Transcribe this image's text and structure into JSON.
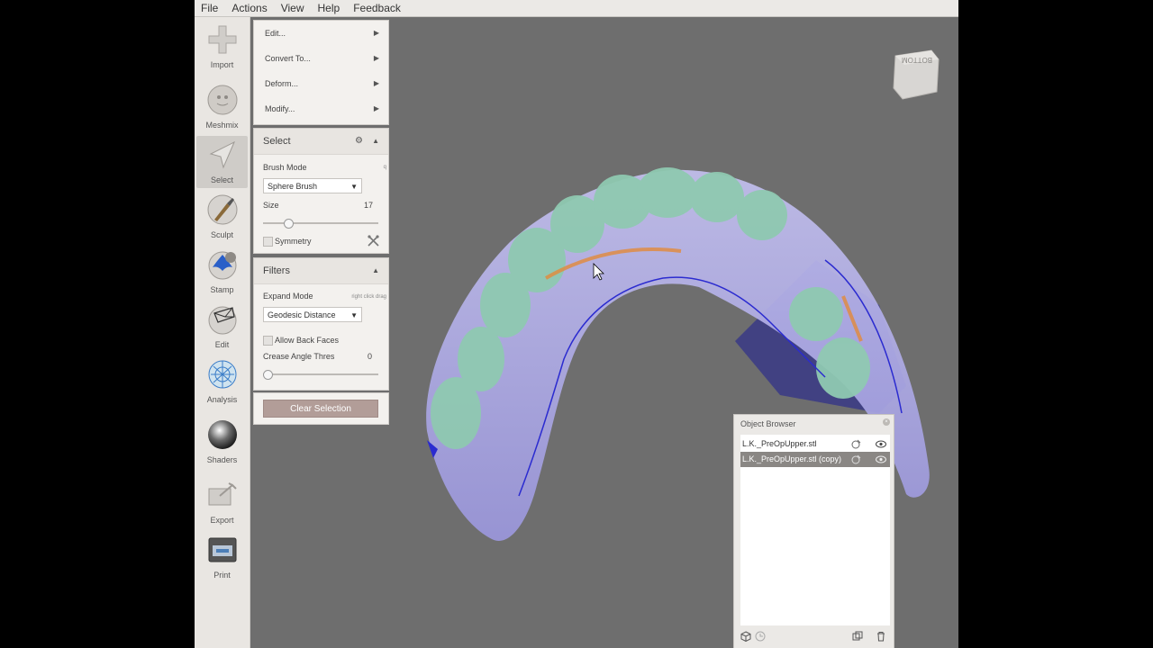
{
  "menubar": {
    "items": [
      "File",
      "Actions",
      "View",
      "Help",
      "Feedback"
    ]
  },
  "toolbar": {
    "tools": [
      {
        "label": "Import",
        "icon": "plus-icon"
      },
      {
        "label": "Meshmix",
        "icon": "meshmix-icon"
      },
      {
        "label": "Select",
        "icon": "select-arrow-icon",
        "active": true
      },
      {
        "label": "Sculpt",
        "icon": "brush-icon"
      },
      {
        "label": "Stamp",
        "icon": "stamp-icon"
      },
      {
        "label": "Edit",
        "icon": "edit-mesh-icon"
      },
      {
        "label": "Analysis",
        "icon": "analysis-icon"
      },
      {
        "label": "Shaders",
        "icon": "shader-sphere-icon"
      },
      {
        "label": "Export",
        "icon": "export-icon"
      },
      {
        "label": "Print",
        "icon": "printer-icon"
      }
    ]
  },
  "edit_menu": {
    "items": [
      "Edit...",
      "Convert To...",
      "Deform...",
      "Modify..."
    ]
  },
  "select_panel": {
    "title": "Select",
    "brush_mode_label": "Brush Mode",
    "brush_mode_hint": "q",
    "brush_mode_value": "Sphere Brush",
    "size_label": "Size",
    "size_value": "17",
    "size_fraction": 0.2,
    "symmetry_label": "Symmetry"
  },
  "filters_panel": {
    "title": "Filters",
    "expand_mode_label": "Expand Mode",
    "expand_mode_hint": "right click drag",
    "expand_mode_value": "Geodesic Distance",
    "allow_back_faces_label": "Allow Back Faces",
    "crease_angle_label": "Crease Angle Thres",
    "crease_angle_value": "0",
    "crease_fraction": 0.0
  },
  "clear_selection_label": "Clear Selection",
  "object_browser": {
    "title": "Object Browser",
    "items": [
      {
        "name": "L.K._PreOpUpper.stl",
        "selected": false
      },
      {
        "name": "L.K._PreOpUpper.stl (copy)",
        "selected": true
      }
    ]
  },
  "view_cube": {
    "face_label": "BOTTOM"
  },
  "colors": {
    "viewport_bg": "#6e6e6e",
    "teeth": "#8fc9b1",
    "shell": "#a9a6e0",
    "selection_outline": "#2b2bd0",
    "highlight_orange": "#e28a3a",
    "clear_button": "#b29d98"
  }
}
